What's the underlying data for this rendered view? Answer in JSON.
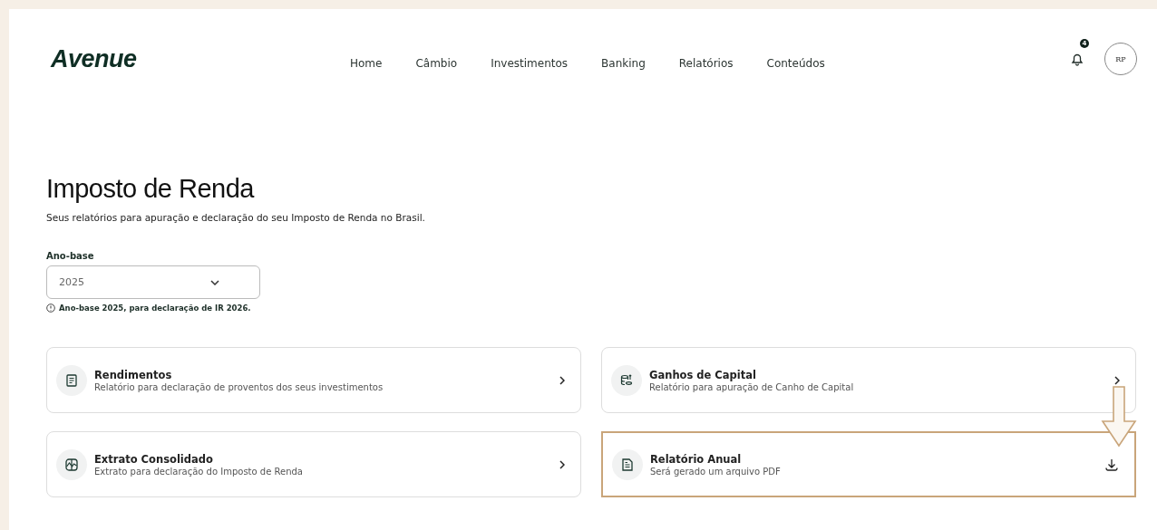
{
  "header": {
    "logo": "Avenue",
    "nav": [
      {
        "label": "Home"
      },
      {
        "label": "Câmbio"
      },
      {
        "label": "Investimentos"
      },
      {
        "label": "Banking"
      },
      {
        "label": "Relatórios"
      },
      {
        "label": "Conteúdos"
      }
    ],
    "notifications": "4",
    "avatar": "RP"
  },
  "page": {
    "title": "Imposto de Renda",
    "subtitle": "Seus relatórios para apuração e declaração do seu Imposto de Renda no Brasil."
  },
  "year_select": {
    "label": "Ano-base",
    "value": "2025",
    "hint": "Ano-base 2025, para declaração de IR 2026."
  },
  "cards": [
    {
      "title": "Rendimentos",
      "description": "Relatório para declaração de proventos dos seus investimentos",
      "kind": "chevron",
      "highlighted": false
    },
    {
      "title": "Ganhos de Capital",
      "description": "Relatório para apuração de Canho de Capital",
      "kind": "chevron",
      "highlighted": false
    },
    {
      "title": "Extrato Consolidado",
      "description": "Extrato para declaração do Imposto de Renda",
      "kind": "chevron",
      "highlighted": false
    },
    {
      "title": "Relatório Anual",
      "description": "Será gerado um arquivo PDF",
      "kind": "download",
      "highlighted": true
    }
  ]
}
